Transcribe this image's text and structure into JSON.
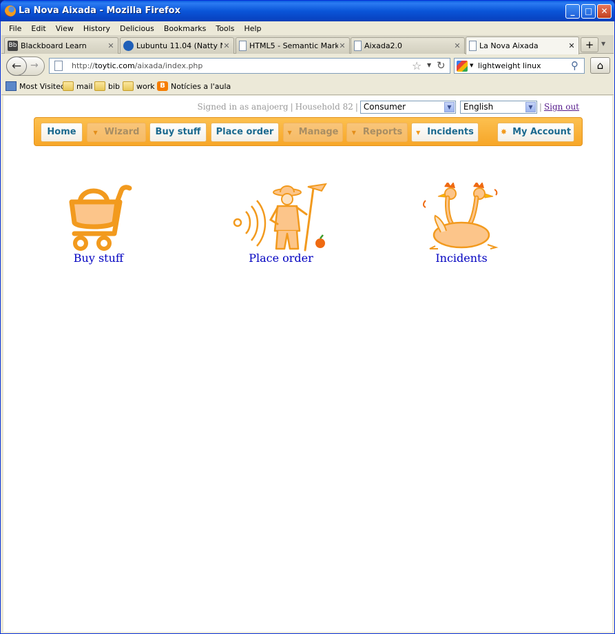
{
  "window": {
    "title": "La Nova Aixada - Mozilla Firefox"
  },
  "menu": [
    "File",
    "Edit",
    "View",
    "History",
    "Delicious",
    "Bookmarks",
    "Tools",
    "Help"
  ],
  "tabs": [
    {
      "label": "Blackboard Learn",
      "icon": "Bb"
    },
    {
      "label": "Lubuntu 11.04 (Natty N...",
      "icon": ""
    },
    {
      "label": "HTML5 - Semantic Mark...",
      "icon": ""
    },
    {
      "label": "Aixada2.0",
      "icon": ""
    },
    {
      "label": "La Nova Aixada",
      "icon": ""
    }
  ],
  "address": {
    "prefix": "http://",
    "domain": "toytic.com",
    "path": "/aixada/index.php"
  },
  "search": {
    "value": "lightweight linux"
  },
  "bookmarks": [
    "Most Visited",
    "mail",
    "bib",
    "work",
    "Notícies a l'aula"
  ],
  "userbar": {
    "signed_in": "Signed in as anajoerg",
    "household": "Household 82",
    "role": "Consumer",
    "language": "English",
    "signout": "Sign out"
  },
  "nav": {
    "home": "Home",
    "wizard": "Wizard",
    "buy": "Buy stuff",
    "order": "Place order",
    "manage": "Manage",
    "reports": "Reports",
    "incidents": "Incidents",
    "account": "My Account"
  },
  "shortcuts": {
    "buy": "Buy stuff",
    "order": "Place order",
    "incidents": "Incidents"
  },
  "colors": {
    "nav_orange": "#f7a628",
    "link_blue": "#0000c0",
    "illustration_orange": "#f29a1e"
  }
}
